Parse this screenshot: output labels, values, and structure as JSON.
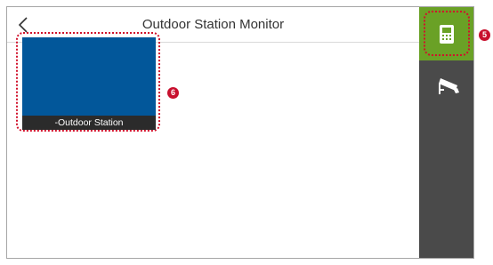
{
  "header": {
    "title": "Outdoor Station Monitor",
    "back_icon": "chevron-left-icon"
  },
  "tiles": [
    {
      "label": "-Outdoor Station",
      "badge": "6"
    }
  ],
  "sidebar": {
    "items": [
      {
        "icon": "door-station-icon",
        "active": true,
        "badge": "5"
      },
      {
        "icon": "cctv-camera-icon",
        "active": false
      }
    ]
  },
  "colors": {
    "accent": "#6aa126",
    "sidebar_bg": "#4a4a4a",
    "tile_video": "#02579a",
    "callout": "#c8102e"
  }
}
